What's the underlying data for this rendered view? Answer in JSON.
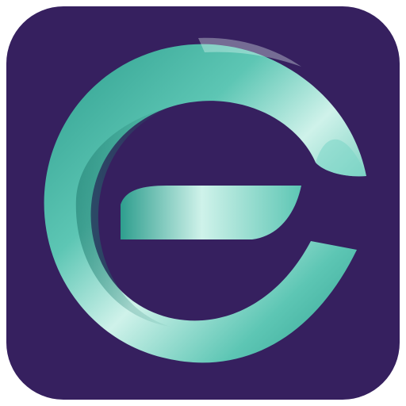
{
  "icon": {
    "name": "e-logo-app-icon",
    "colors": {
      "background": "#36205F",
      "teal_dark": "#2E9E8E",
      "teal_mid": "#5DC6B4",
      "teal_light": "#CFF2EA",
      "highlight": "#EAFBF8"
    }
  }
}
